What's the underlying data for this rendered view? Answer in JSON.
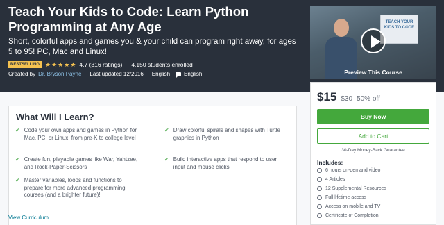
{
  "hero": {
    "title": "Teach Your Kids to Code: Learn Python Programming at Any Age",
    "subtitle": "Short, colorful apps and games you & your child can program right away, for ages 5 to 95! PC, Mac and Linux!",
    "badge": "Bestselling",
    "rating_text": "4.7 (316 ratings)",
    "rating_value": 4.7,
    "enrolled": "4,150 students enrolled",
    "created_by_label": "Created by",
    "author": "Dr. Bryson Payne",
    "last_updated": "Last updated 12/2016",
    "language": "English",
    "captions": "English"
  },
  "video": {
    "board_text": "TEACH YOUR KIDS TO CODE",
    "preview_label": "Preview This Course"
  },
  "learn": {
    "title": "What Will I Learn?",
    "items": [
      "Code your own apps and games in Python for Mac, PC, or Linux, from pre-K to college level",
      "Draw colorful spirals and shapes with Turtle graphics in Python",
      "Create fun, playable games like War, Yahtzee, and Rock-Paper-Scissors",
      "Build interactive apps that respond to user input and mouse clicks",
      "Master variables, loops and functions to prepare for more advanced programming courses (and a brighter future)!"
    ],
    "view_link": "View Curriculum"
  },
  "buy": {
    "price": "$15",
    "original_price": "$30",
    "discount": "50% off",
    "buy_label": "Buy Now",
    "cart_label": "Add to Cart",
    "guarantee": "30-Day Money-Back Guarantee",
    "includes_title": "Includes:",
    "includes": [
      "6 hours on-demand video",
      "4 Articles",
      "12 Supplemental Resources",
      "Full lifetime access",
      "Access on mobile and TV",
      "Certificate of Completion"
    ]
  },
  "colors": {
    "hero_bg": "#29303b",
    "accent_green": "#44a83c",
    "star_yellow": "#f4c150",
    "link_blue": "#007791"
  }
}
